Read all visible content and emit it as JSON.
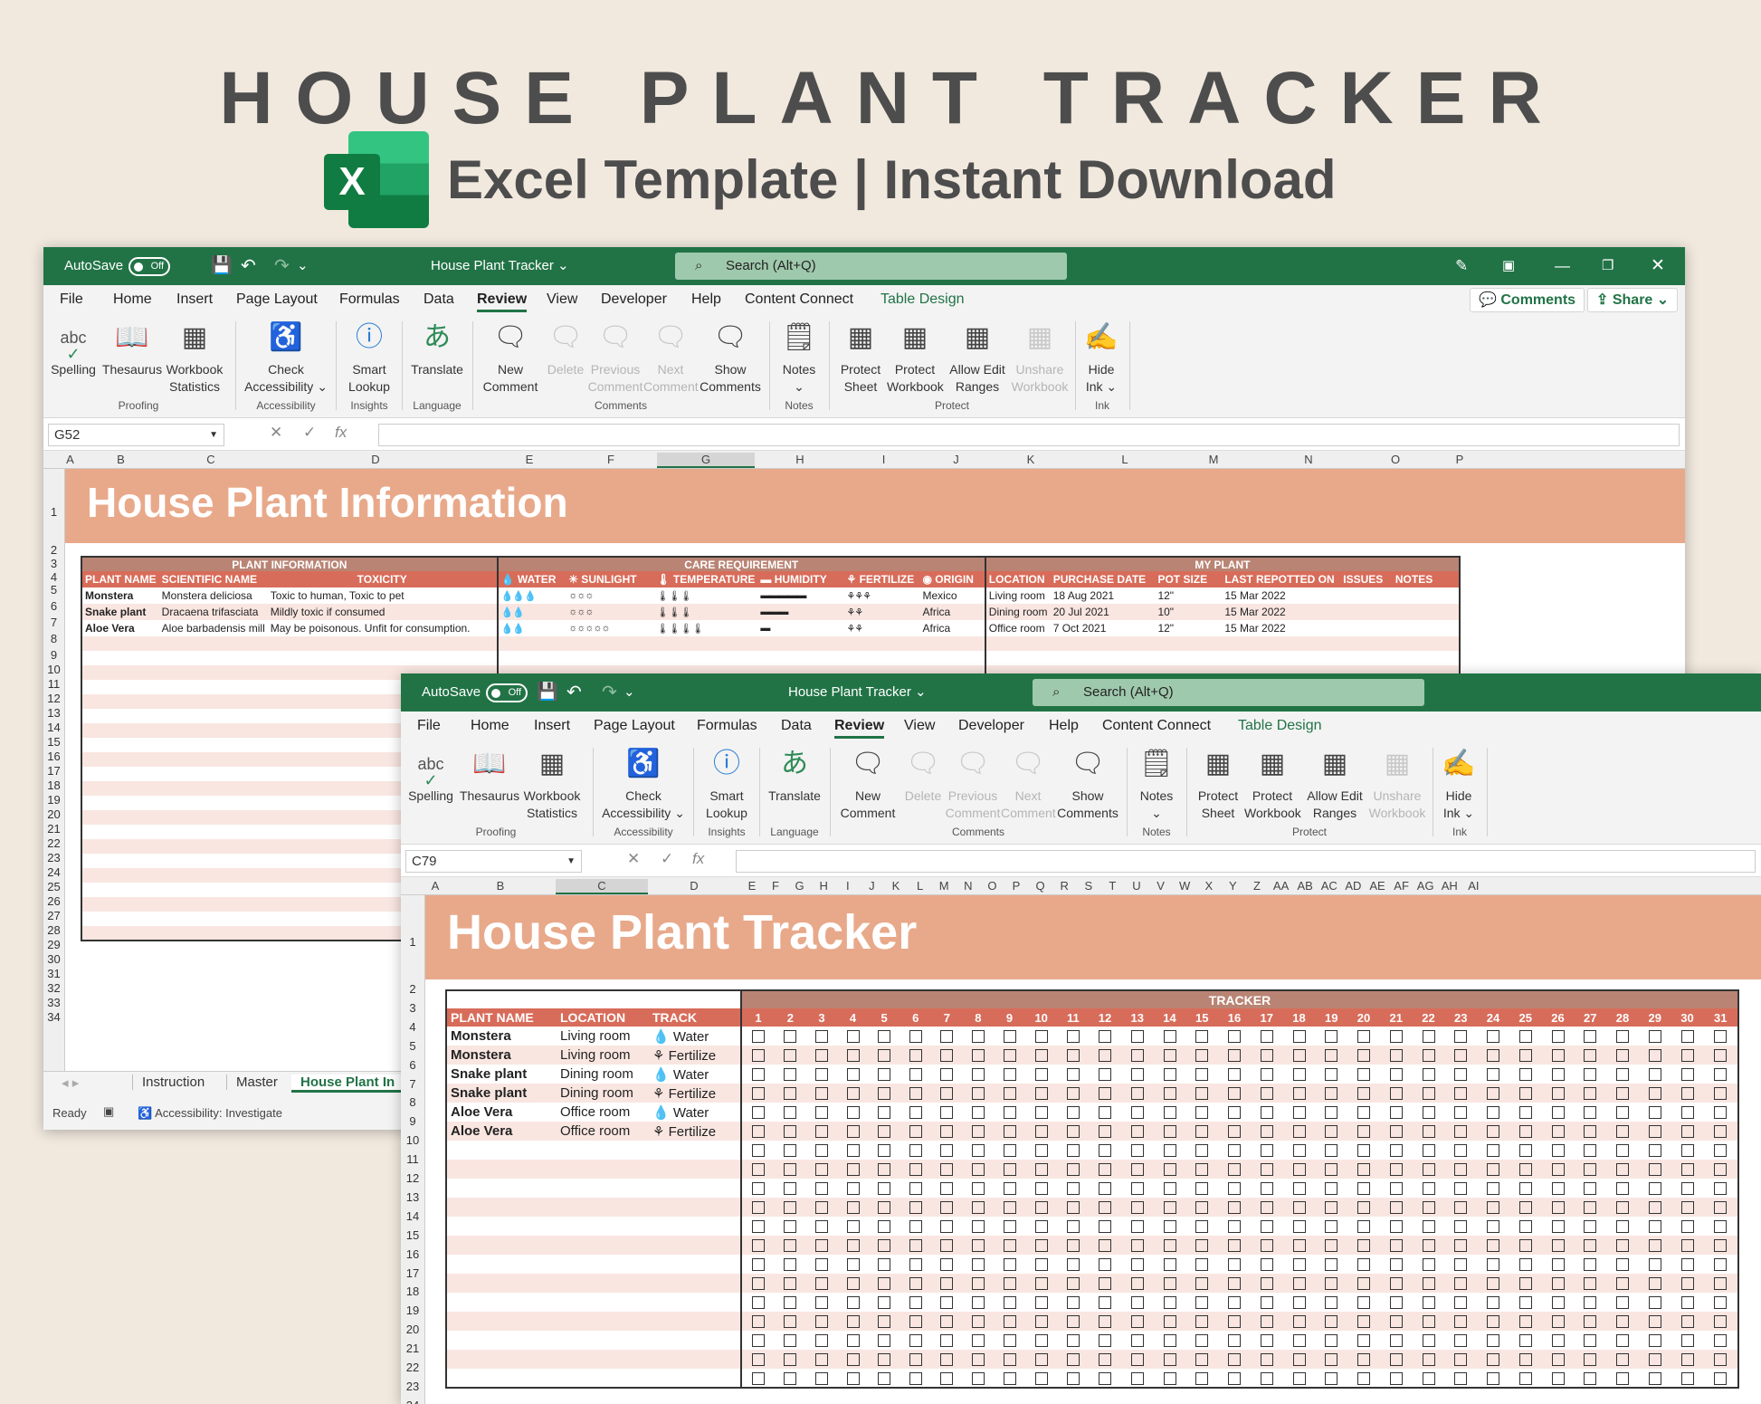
{
  "hero": {
    "title": "HOUSE PLANT TRACKER",
    "subtitle": "Excel Template | Instant Download",
    "logo_letter": "X"
  },
  "colors": {
    "excel_green": "#217346",
    "banner": "#e8a98a",
    "header_row": "#d86c5a",
    "section_row": "#b98474",
    "stripe": "#f9e6e1",
    "background": "#f1e9de"
  },
  "menu": [
    "File",
    "Home",
    "Insert",
    "Page Layout",
    "Formulas",
    "Data",
    "Review",
    "View",
    "Developer",
    "Help",
    "Content Connect",
    "Table Design"
  ],
  "ribbon": {
    "spelling": "Spelling",
    "thesaurus": "Thesaurus",
    "workbook": "Workbook",
    "statistics": "Statistics",
    "check": "Check",
    "accessibility": "Accessibility ⌄",
    "smart": "Smart",
    "lookup": "Lookup",
    "translate": "Translate",
    "new": "New",
    "comment": "Comment",
    "delete": "Delete",
    "previous": "Previous",
    "next": "Next",
    "show": "Show",
    "comments": "Comments",
    "notes": "Notes",
    "notes_caret": "⌄",
    "protect": "Protect",
    "sheet": "Sheet",
    "protect_wb": "Workbook",
    "allow_edit": "Allow Edit",
    "ranges": "Ranges",
    "unshare": "Unshare",
    "unshare_wb": "Workbook",
    "hide": "Hide",
    "ink": "Ink ⌄",
    "groups": {
      "proofing": "Proofing",
      "accessibility": "Accessibility",
      "insights": "Insights",
      "language": "Language",
      "comments": "Comments",
      "notes": "Notes",
      "protect": "Protect",
      "ink": "Ink"
    }
  },
  "win1": {
    "autosave": "AutoSave",
    "toggle": "Off",
    "doc_title": "House Plant Tracker ⌄",
    "search": "Search (Alt+Q)",
    "comments_btn": "Comments",
    "share_btn": "Share",
    "namebox": "G52",
    "cols": [
      "A",
      "B",
      "C",
      "D",
      "E",
      "F",
      "G",
      "H",
      "I",
      "J",
      "K",
      "L",
      "M",
      "N",
      "O",
      "P"
    ],
    "banner": "House Plant Information",
    "sections": {
      "plant": "PLANT INFORMATION",
      "care": "CARE REQUIREMENT",
      "my": "MY PLANT"
    },
    "headers": [
      "PLANT NAME",
      "SCIENTIFIC NAME",
      "TOXICITY",
      "💧 WATER",
      "☀ SUNLIGHT",
      "🌡 TEMPERATURE",
      "▬ HUMIDITY",
      "⚘ FERTILIZE",
      "◉ ORIGIN",
      "LOCATION",
      "PURCHASE DATE",
      "POT SIZE",
      "LAST REPOTTED ON",
      "ISSUES",
      "NOTES"
    ],
    "rows": [
      [
        "Monstera",
        "Monstera deliciosa",
        "Toxic to human, Toxic to pet",
        "💧💧💧",
        "☼☼☼",
        "🌡🌡🌡",
        "▬▬▬▬▬",
        "⚘⚘⚘",
        "Mexico",
        "Living room",
        "18 Aug 2021",
        "12\"",
        "15 Mar 2022",
        "",
        ""
      ],
      [
        "Snake plant",
        "Dracaena trifasciata",
        "Mildly toxic if consumed",
        "💧💧",
        "☼☼☼",
        "🌡🌡🌡",
        "▬▬▬",
        "⚘⚘",
        "Africa",
        "Dining room",
        "20 Jul 2021",
        "10\"",
        "15 Mar 2022",
        "",
        ""
      ],
      [
        "Aloe Vera",
        "Aloe barbadensis mill",
        "May be poisonous. Unfit for consumption.",
        "💧💧",
        "☼☼☼☼☼",
        "🌡🌡🌡🌡",
        "▬",
        "⚘⚘",
        "Africa",
        "Office room",
        "7 Oct 2021",
        "12\"",
        "15 Mar 2022",
        "",
        ""
      ]
    ],
    "tabs": [
      "Instruction",
      "Master",
      "House Plant In"
    ],
    "status": "Ready",
    "status_access": "Accessibility: Investigate"
  },
  "win2": {
    "autosave": "AutoSave",
    "toggle": "Off",
    "doc_title": "House Plant Tracker ⌄",
    "search": "Search (Alt+Q)",
    "namebox": "C79",
    "cols": [
      "A",
      "B",
      "C",
      "D",
      "E",
      "F",
      "G",
      "H",
      "I",
      "J",
      "K",
      "L",
      "M",
      "N",
      "O",
      "P",
      "Q",
      "R",
      "S",
      "T",
      "U",
      "V",
      "W",
      "X",
      "Y",
      "Z",
      "AA",
      "AB",
      "AC",
      "AD",
      "AE",
      "AF",
      "AG",
      "AH",
      "AI"
    ],
    "banner": "House Plant Tracker",
    "section": "TRACKER",
    "headers": [
      "PLANT NAME",
      "LOCATION",
      "TRACK"
    ],
    "days": [
      "1",
      "2",
      "3",
      "4",
      "5",
      "6",
      "7",
      "8",
      "9",
      "10",
      "11",
      "12",
      "13",
      "14",
      "15",
      "16",
      "17",
      "18",
      "19",
      "20",
      "21",
      "22",
      "23",
      "24",
      "25",
      "26",
      "27",
      "28",
      "29",
      "30",
      "31"
    ],
    "rows": [
      [
        "Monstera",
        "Living room",
        "💧 Water"
      ],
      [
        "Monstera",
        "Living room",
        "⚘ Fertilize"
      ],
      [
        "Snake plant",
        "Dining room",
        "💧 Water"
      ],
      [
        "Snake plant",
        "Dining room",
        "⚘ Fertilize"
      ],
      [
        "Aloe Vera",
        "Office room",
        "💧 Water"
      ],
      [
        "Aloe Vera",
        "Office room",
        "⚘ Fertilize"
      ]
    ]
  }
}
